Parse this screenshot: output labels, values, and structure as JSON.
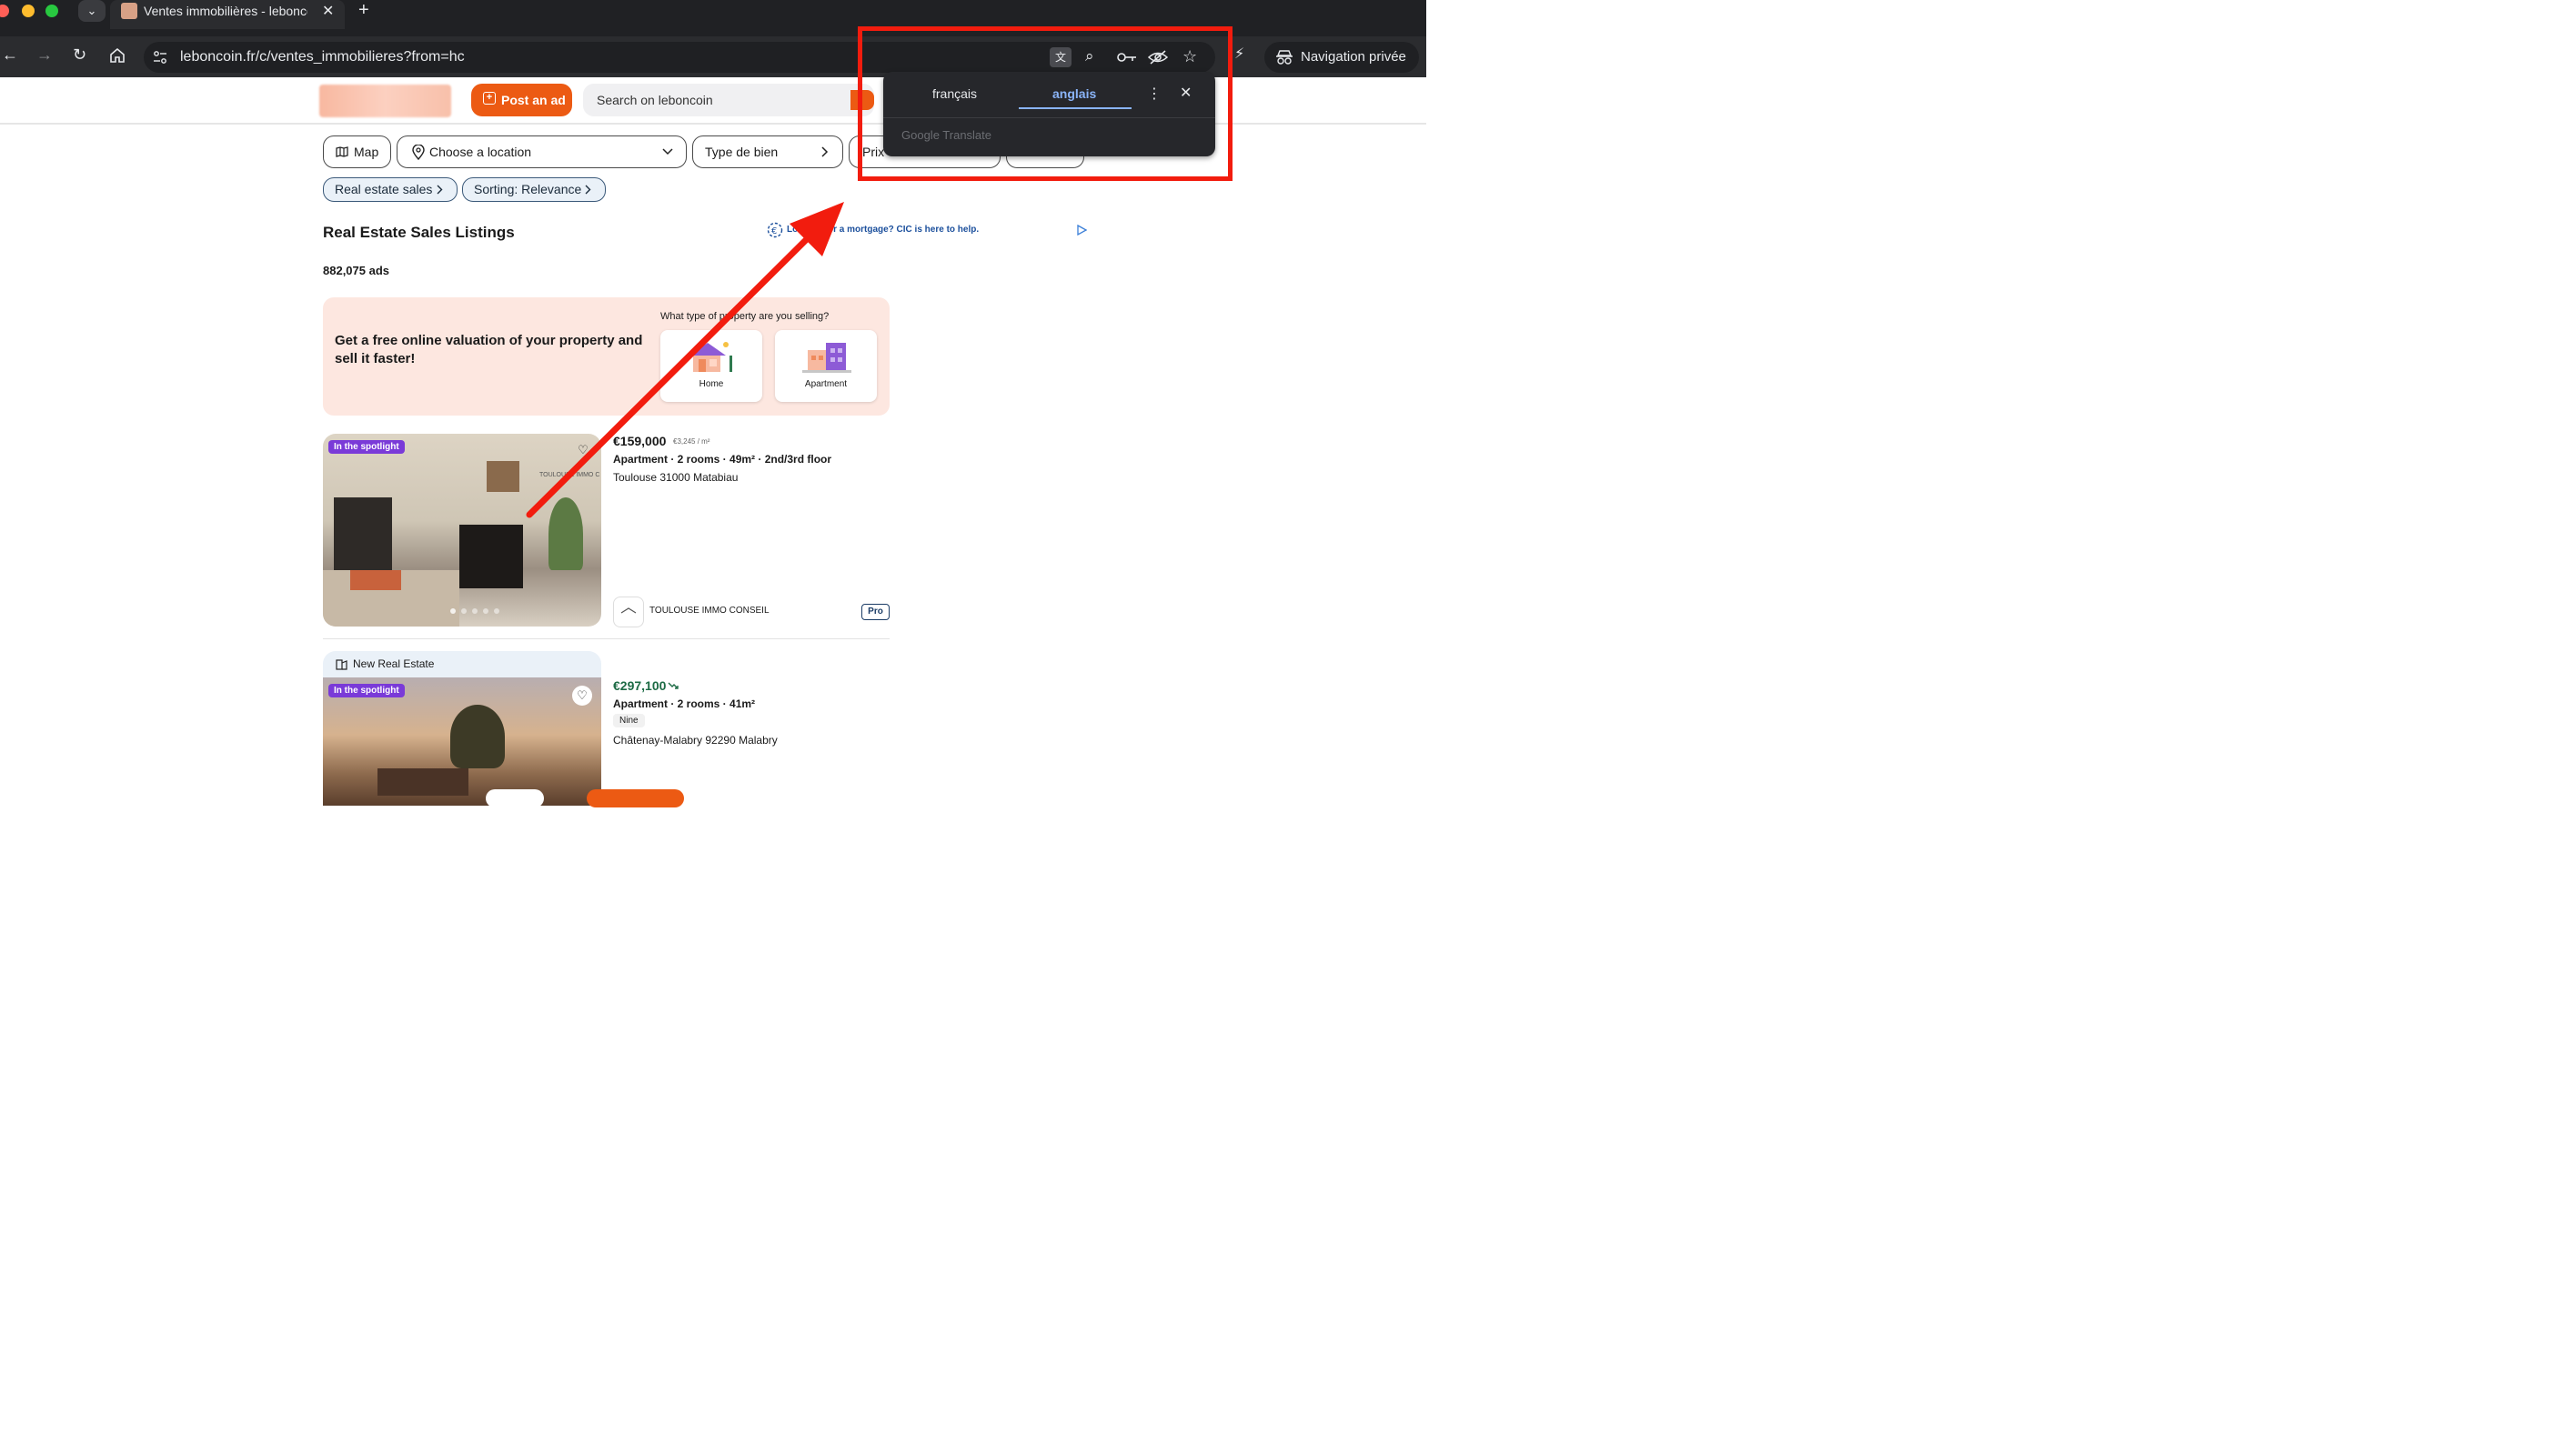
{
  "browser": {
    "tab_title": "Ventes immobilières - leboncoin",
    "tab_close": "✕",
    "new_tab": "+",
    "url": "leboncoin.fr/c/ventes_immobilieres?from=hc",
    "private_label": "Navigation privée",
    "colors": {
      "traffic_red": "#ff5f57",
      "traffic_yellow": "#febc2e",
      "traffic_green": "#28c840"
    }
  },
  "header": {
    "post_ad_label": "Post an ad",
    "search_placeholder": "Search on leboncoin",
    "accent": "#ec5a13"
  },
  "filters": {
    "map_label": "Map",
    "location_label": "Choose a location",
    "property_type_label": "Type de bien",
    "price_label": "Prix",
    "category_pill": "Real estate sales",
    "sorting_pill": "Sorting: Relevance"
  },
  "main": {
    "title": "Real Estate Sales Listings",
    "ads_count": "882,075 ads",
    "ad_text": "Looking for a mortgage? CIC is here to help.",
    "promo": {
      "title": "Get a free online valuation of your property and sell it faster!",
      "question": "What type of property are you selling?",
      "options": [
        "Home",
        "Apartment"
      ]
    },
    "listings": [
      {
        "badge": "In the spotlight",
        "watermark": "TOULOUSE IMMO C",
        "price": "€159,000",
        "price_per_m2": "€3,245 / m²",
        "details": "Apartment · 2 rooms · 49m² · 2nd/3rd floor",
        "location": "Toulouse 31000 Matabiau",
        "seller": "TOULOUSE IMMO CONSEIL",
        "seller_tag": "Pro"
      },
      {
        "header": "New Real Estate",
        "badge": "In the spotlight",
        "price": "€297,100",
        "details": "Apartment · 2 rooms · 41m²",
        "tag": "Nine",
        "location": "Châtenay-Malabry 92290 Malabry"
      }
    ]
  },
  "translate_popup": {
    "source_lang": "français",
    "target_lang": "anglais",
    "provider": "Google Translate",
    "accent": "#8ab4f8"
  },
  "annotation": {
    "color": "#f21c0e"
  }
}
